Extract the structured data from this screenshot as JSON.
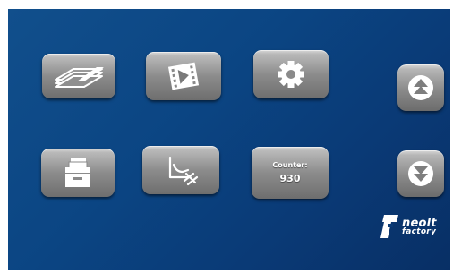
{
  "tiles": {
    "documents": {
      "icon": "stacked-papers-icon"
    },
    "media": {
      "icon": "film-play-icon"
    },
    "settings": {
      "icon": "gear-icon"
    },
    "archive": {
      "icon": "file-drawer-icon"
    },
    "tool": {
      "icon": "slicer-tool-icon"
    },
    "counter": {
      "label": "Counter:",
      "value": "930"
    }
  },
  "nav": {
    "up": {
      "icon": "arrow-up-icon"
    },
    "down": {
      "icon": "arrow-down-icon"
    }
  },
  "logo": {
    "line1": "neolt",
    "line2": "factory",
    "mark": "neolt-logo-mark"
  },
  "colors": {
    "background": "#0b4583",
    "tile": "#8c8c8c",
    "icon": "#ffffff"
  }
}
